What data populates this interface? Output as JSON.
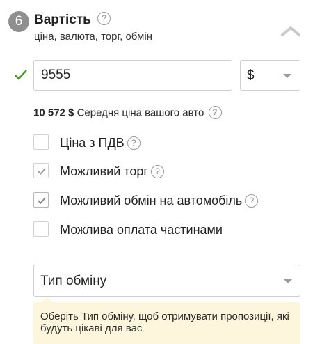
{
  "section": {
    "step_number": "6",
    "title": "Вартість",
    "subtitle": "ціна, валюта, торг, обмін",
    "help_icon_glyph": "?"
  },
  "price": {
    "value": "9555",
    "currency": "$",
    "valid_color": "#4a9a1c"
  },
  "average": {
    "amount": "10 572 $",
    "label": "Середня ціна вашого авто"
  },
  "options": [
    {
      "label": "Ціна з ПДВ",
      "checked": false,
      "has_help": true
    },
    {
      "label": "Можливий торг",
      "checked": true,
      "has_help": true
    },
    {
      "label": "Можливий обмін на автомобіль",
      "checked": true,
      "has_help": true
    },
    {
      "label": "Можлива оплата частинами",
      "checked": false,
      "has_help": false
    }
  ],
  "exchange_type": {
    "placeholder": "Тип обміну"
  },
  "hint": {
    "text": "Оберіть Тип обміну, щоб отримувати пропозиції, які будуть цікаві для вас"
  },
  "icons": {
    "collapse": "chevron-up-icon",
    "valid": "checkmark-icon",
    "help": "question-circle-icon",
    "dropdown": "caret-down-icon"
  }
}
